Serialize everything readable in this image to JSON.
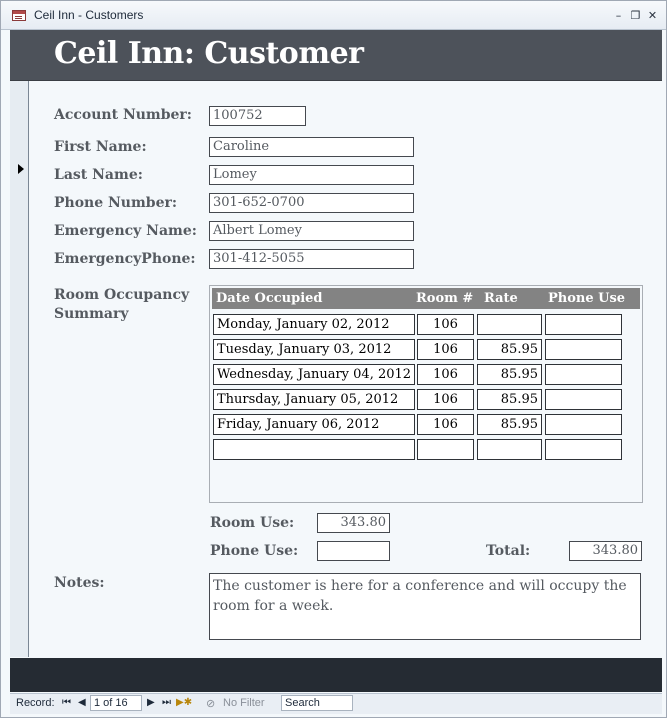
{
  "window": {
    "title": "Ceil Inn - Customers",
    "minimize_label": "–",
    "restore_label": "❐",
    "close_label": "✕"
  },
  "form": {
    "header_title": "Ceil Inn: Customer",
    "record_selector_glyph": "▶"
  },
  "fields": {
    "account_number": {
      "label": "Account Number:",
      "value": "100752"
    },
    "first_name": {
      "label": "First Name:",
      "value": "Caroline"
    },
    "last_name": {
      "label": "Last Name:",
      "value": "Lomey"
    },
    "phone_number": {
      "label": "Phone Number:",
      "value": "301-652-0700"
    },
    "emergency_name": {
      "label": "Emergency Name:",
      "value": "Albert Lomey"
    },
    "emergency_phone": {
      "label": "EmergencyPhone:",
      "value": "301-412-5055"
    }
  },
  "occupancy": {
    "label_line1": "Room Occupancy",
    "label_line2": "Summary",
    "headers": {
      "date": "Date Occupied",
      "room": "Room #",
      "rate": "Rate",
      "phone": "Phone Use"
    },
    "rows": [
      {
        "date": "Monday, January 02, 2012",
        "room": "106",
        "rate": "",
        "phone": ""
      },
      {
        "date": "Tuesday, January 03, 2012",
        "room": "106",
        "rate": "85.95",
        "phone": ""
      },
      {
        "date": "Wednesday, January 04, 2012",
        "room": "106",
        "rate": "85.95",
        "phone": ""
      },
      {
        "date": "Thursday, January 05, 2012",
        "room": "106",
        "rate": "85.95",
        "phone": ""
      },
      {
        "date": "Friday, January 06, 2012",
        "room": "106",
        "rate": "85.95",
        "phone": ""
      },
      {
        "date": "",
        "room": "",
        "rate": "",
        "phone": ""
      }
    ]
  },
  "totals": {
    "room_use_label": "Room Use:",
    "room_use_value": "343.80",
    "phone_use_label": "Phone Use:",
    "phone_use_value": "",
    "total_label": "Total:",
    "total_value": "343.80"
  },
  "notes": {
    "label": "Notes:",
    "value": "The customer is here for a conference and will occupy the room for a week."
  },
  "navigation": {
    "record_label": "Record:",
    "first_glyph": "⏮",
    "prev_glyph": "◀",
    "position": "1 of 16",
    "next_glyph": "▶",
    "last_glyph": "⏭",
    "new_glyph": "▶✱",
    "filter_label": "No Filter",
    "search_placeholder": "Search"
  }
}
